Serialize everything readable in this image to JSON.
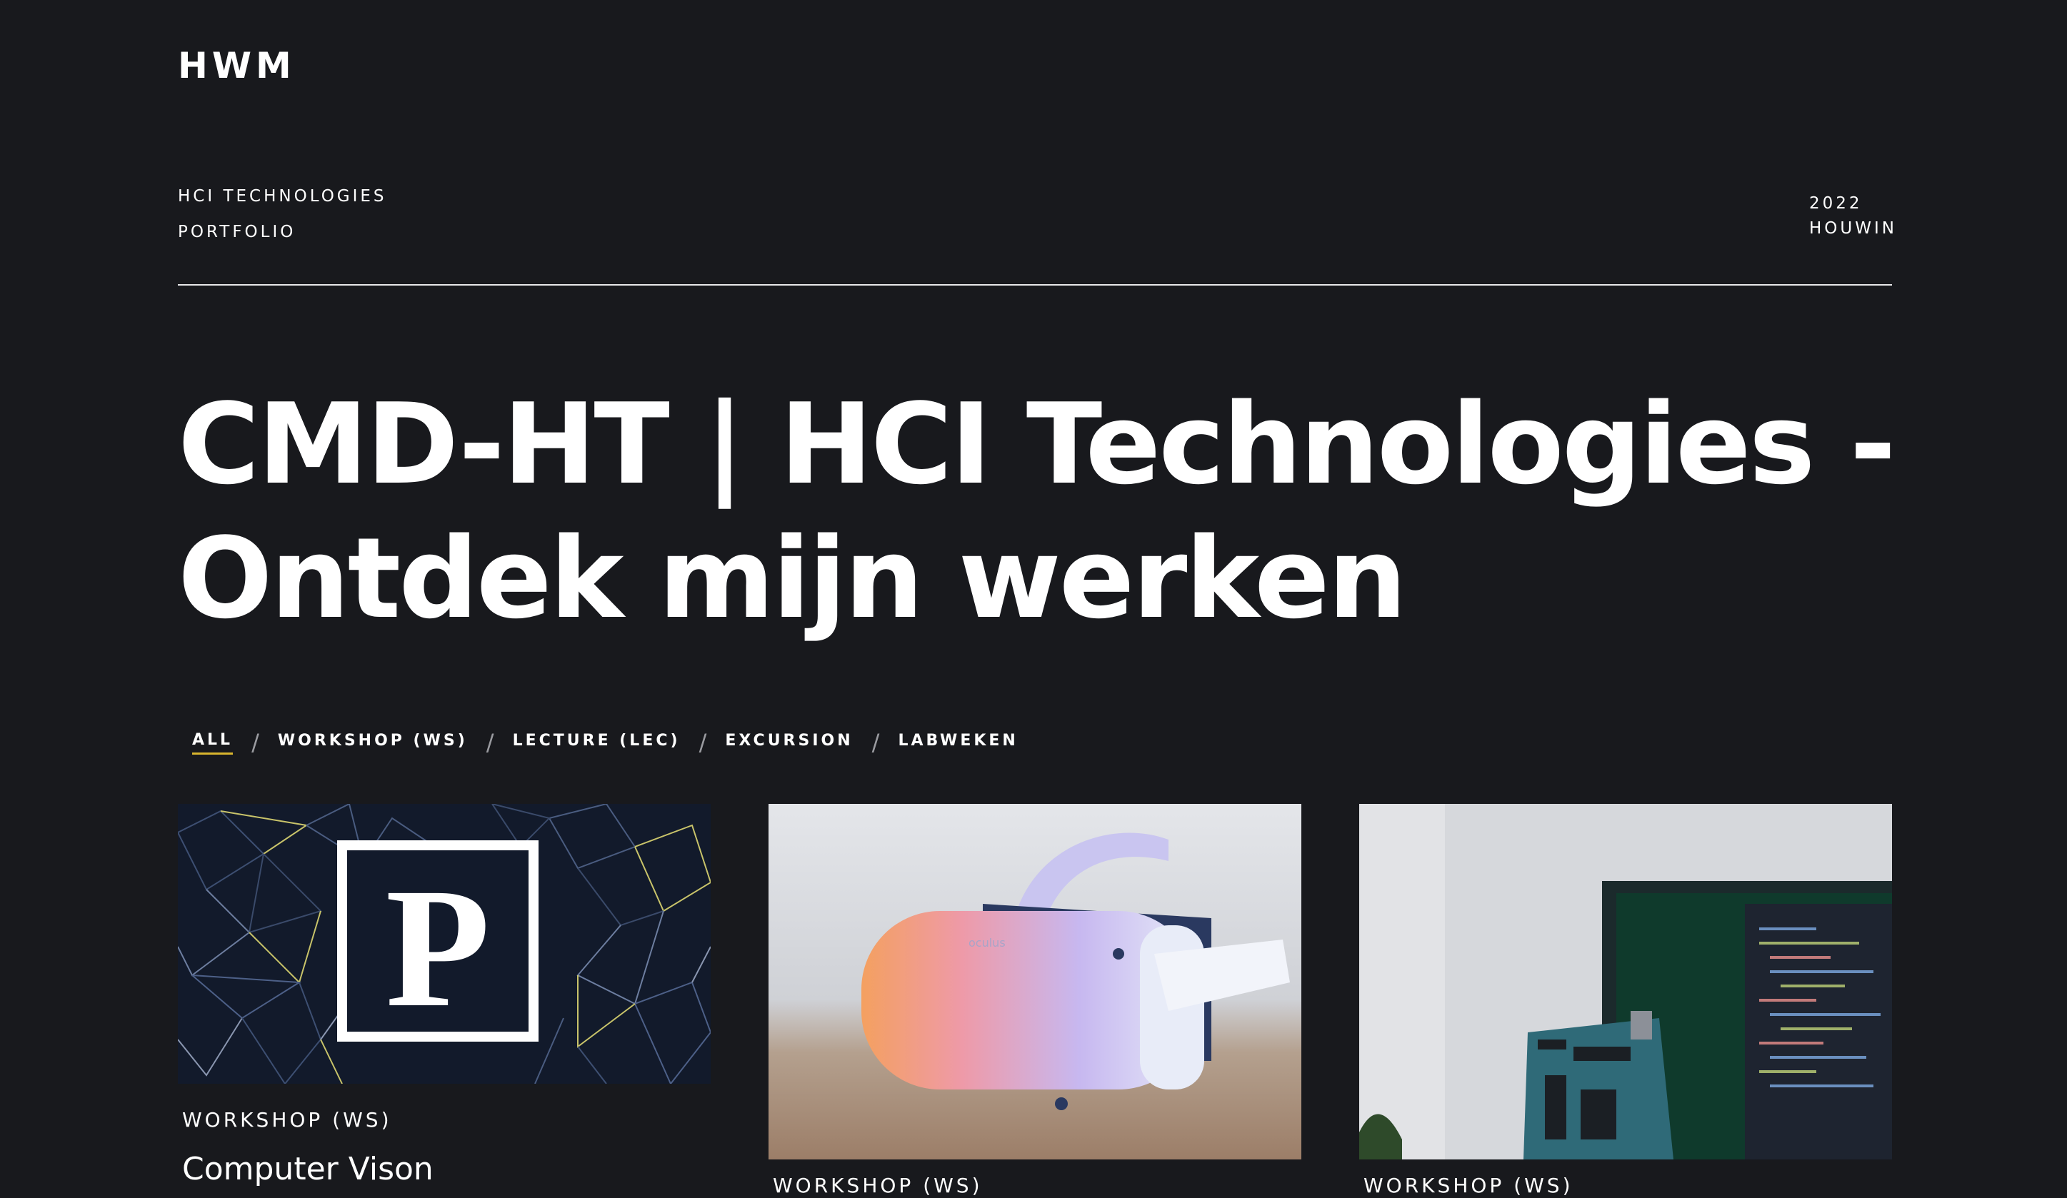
{
  "site": {
    "logo": "HWM"
  },
  "meta": {
    "left": [
      "HCI TECHNOLOGIES",
      "PORTFOLIO"
    ],
    "right": [
      "2022",
      "HOUWIN"
    ]
  },
  "hero": {
    "title": "CMD-HT | HCI Technologies - Ontdek mijn werken"
  },
  "filters": {
    "items": [
      {
        "label": "ALL",
        "active": true
      },
      {
        "label": "WORKSHOP (WS)",
        "active": false
      },
      {
        "label": "LECTURE (LEC)",
        "active": false
      },
      {
        "label": "EXCURSION",
        "active": false
      },
      {
        "label": "LABWEKEN",
        "active": false
      }
    ],
    "separator": "/"
  },
  "cards": [
    {
      "tag": "WORKSHOP (WS)",
      "title": "Computer Vison",
      "image_logo": "P"
    },
    {
      "tag": "WORKSHOP (WS)",
      "title": "",
      "image_text": "oculus"
    },
    {
      "tag": "WORKSHOP (WS)",
      "title": ""
    }
  ],
  "colors": {
    "background": "#18191d",
    "text": "#ffffff",
    "accent": "#d8b52e",
    "divider": "#e8e8ea"
  }
}
